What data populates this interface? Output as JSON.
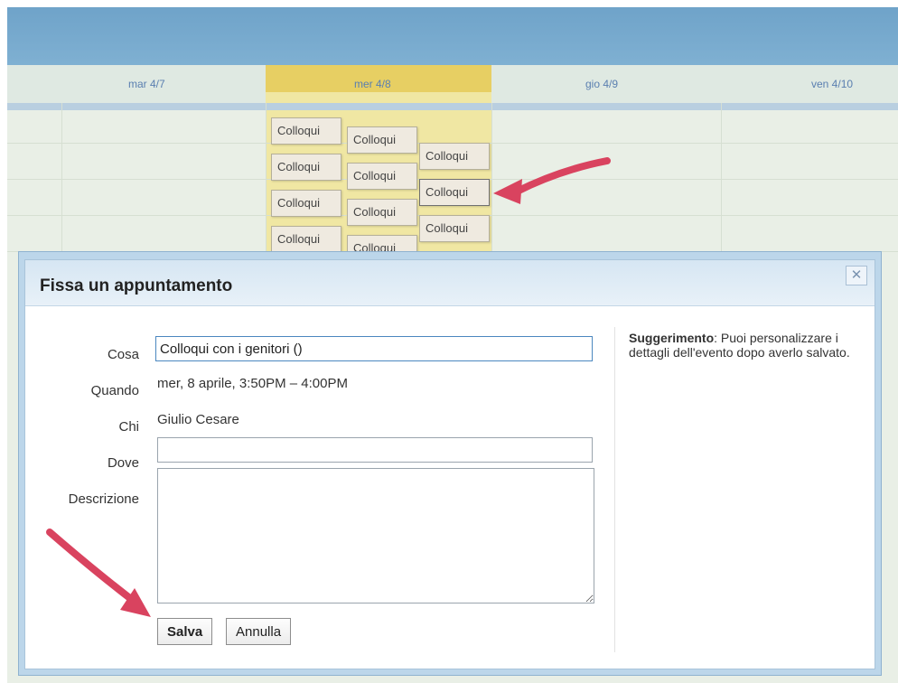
{
  "calendar": {
    "days": [
      {
        "label": "mar 4/7"
      },
      {
        "label": "mer 4/8"
      },
      {
        "label": "gio 4/9"
      },
      {
        "label": "ven 4/10"
      }
    ],
    "slots": [
      {
        "label": "Colloqui"
      },
      {
        "label": "Colloqui"
      },
      {
        "label": "Colloqui"
      },
      {
        "label": "Colloqui"
      },
      {
        "label": "Colloqui"
      },
      {
        "label": "Colloqui"
      },
      {
        "label": "Colloqui"
      },
      {
        "label": "Colloqui"
      },
      {
        "label": "Colloqui"
      },
      {
        "label": "Colloqui"
      },
      {
        "label": "Colloqui"
      }
    ]
  },
  "dialog": {
    "title": "Fissa un appuntamento",
    "close_glyph": "✕",
    "labels": {
      "cosa": "Cosa",
      "quando": "Quando",
      "chi": "Chi",
      "dove": "Dove",
      "descrizione": "Descrizione"
    },
    "cosa_value": "Colloqui con i genitori ()",
    "quando_value": "mer, 8 aprile, 3:50PM – 4:00PM",
    "chi_value": "Giulio Cesare",
    "dove_value": "",
    "descrizione_value": "",
    "tip_bold": "Suggerimento",
    "tip_text": ": Puoi personalizzare i dettagli dell'evento dopo averlo salvato.",
    "save_label": "Salva",
    "cancel_label": "Annulla"
  },
  "colors": {
    "annotation_arrow": "#d9435f",
    "wednesday_highlight": "#e7cf63"
  },
  "icons": [
    "close-icon",
    "annotation-arrow-icon"
  ]
}
